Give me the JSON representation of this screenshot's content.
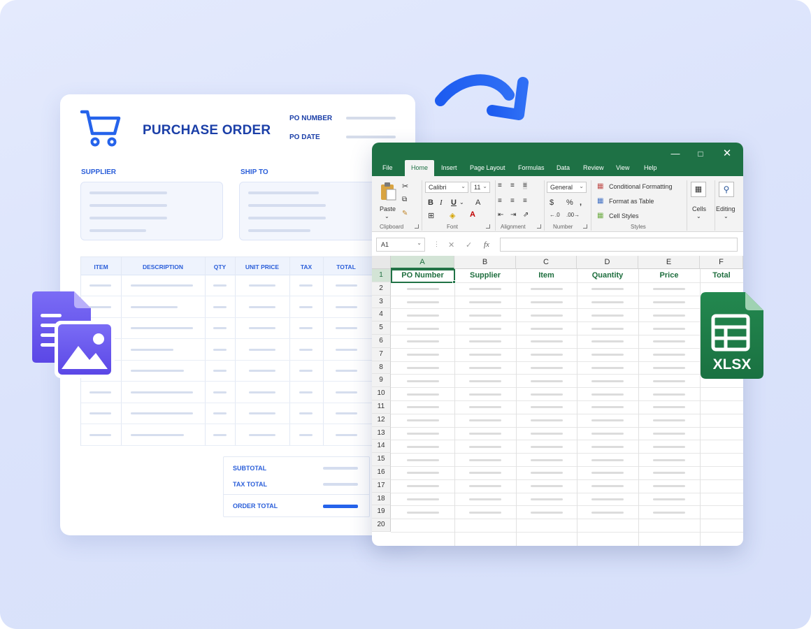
{
  "purchase_order": {
    "title": "PURCHASE ORDER",
    "po_number_label": "PO NUMBER",
    "po_date_label": "PO DATE",
    "supplier_label": "SUPPLIER",
    "ship_to_label": "SHIP TO",
    "table_headers": [
      "ITEM",
      "DESCRIPTION",
      "QTY",
      "UNIT PRICE",
      "TAX",
      "TOTAL"
    ],
    "subtotal_label": "SUBTOTAL",
    "tax_total_label": "TAX TOTAL",
    "order_total_label": "ORDER TOTAL"
  },
  "excel": {
    "tabs": [
      "File",
      "Home",
      "Insert",
      "Page Layout",
      "Formulas",
      "Data",
      "Review",
      "View",
      "Help"
    ],
    "active_tab": "Home",
    "ribbon": {
      "paste": "Paste",
      "clipboard": "Clipboard",
      "font_name": "Calibri",
      "font_size": "11",
      "font": "Font",
      "alignment": "Alignment",
      "number_format": "General",
      "number": "Number",
      "conditional_formatting": "Conditional Formatting",
      "format_as_table": "Format as Table",
      "cell_styles": "Cell Styles",
      "styles": "Styles",
      "cells": "Cells",
      "editing": "Editing"
    },
    "name_box": "A1",
    "columns": [
      "A",
      "B",
      "C",
      "D",
      "E",
      "F"
    ],
    "header_row": [
      "PO Number",
      "Supplier",
      "Item",
      "Quantity",
      "Price",
      "Total"
    ],
    "row_numbers": [
      "1",
      "2",
      "3",
      "4",
      "5",
      "6",
      "7",
      "8",
      "9",
      "10",
      "11",
      "12",
      "13",
      "14",
      "15",
      "16",
      "17",
      "18",
      "19",
      "20"
    ]
  },
  "xlsx_badge": "XLSX",
  "colors": {
    "excel_green": "#1e7145",
    "brand_blue": "#2563eb",
    "doc_purple": "#6d5cf0",
    "po_title": "#1b3fa8"
  }
}
